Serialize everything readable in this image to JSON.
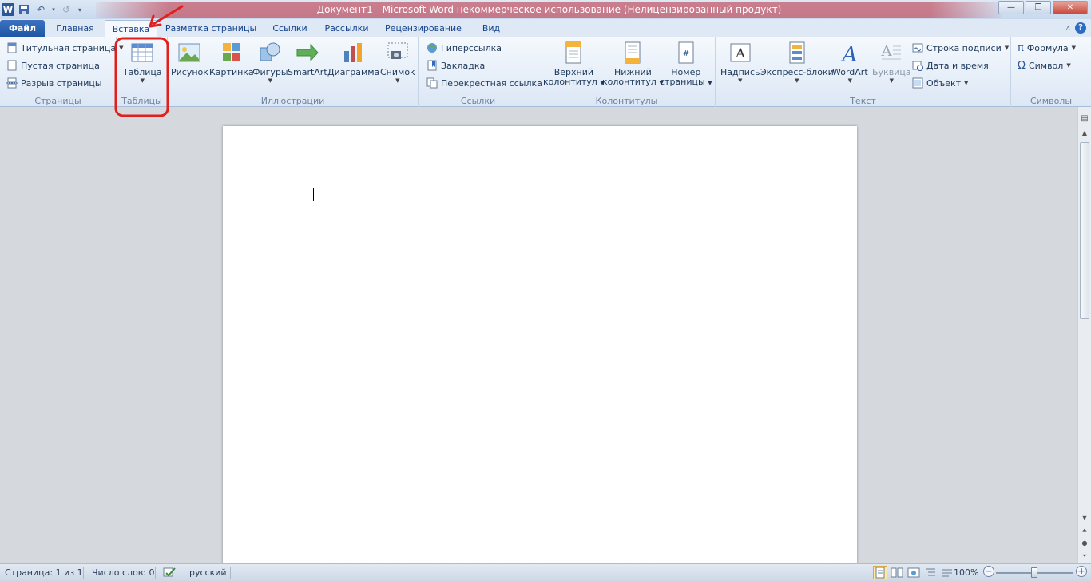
{
  "titlebar": {
    "title": "Документ1 - Microsoft Word некоммерческое использование (Нелицензированный продукт)",
    "app_icon_letter": "W",
    "undo": "↶",
    "redo": "↺",
    "minimize": "—",
    "maximize": "❐",
    "close": "✕"
  },
  "tabs": {
    "file": "Файл",
    "home": "Главная",
    "insert": "Вставка",
    "layout": "Разметка страницы",
    "refs": "Ссылки",
    "mailings": "Рассылки",
    "review": "Рецензирование",
    "view": "Вид"
  },
  "groups": {
    "pages": {
      "label": "Страницы",
      "cover": "Титульная страница",
      "blank": "Пустая страница",
      "break": "Разрыв страницы"
    },
    "tables": {
      "label": "Таблицы",
      "table": "Таблица"
    },
    "illustrations": {
      "label": "Иллюстрации",
      "picture": "Рисунок",
      "clipart": "Картинка",
      "shapes": "Фигуры",
      "smartart": "SmartArt",
      "chart": "Диаграмма",
      "screenshot": "Снимок"
    },
    "links": {
      "label": "Ссылки",
      "hyperlink": "Гиперссылка",
      "bookmark": "Закладка",
      "crossref": "Перекрестная ссылка"
    },
    "headerfooter": {
      "label": "Колонтитулы",
      "header_l1": "Верхний",
      "header_l2": "колонтитул",
      "footer_l1": "Нижний",
      "footer_l2": "колонтитул",
      "pagenum_l1": "Номер",
      "pagenum_l2": "страницы"
    },
    "text": {
      "label": "Текст",
      "textbox": "Надпись",
      "quickparts": "Экспресс-блоки",
      "wordart": "WordArt",
      "dropcap": "Буквица",
      "sigline": "Строка подписи",
      "datetime": "Дата и время",
      "object": "Объект"
    },
    "symbols": {
      "label": "Символы",
      "equation": "Формула",
      "symbol": "Символ",
      "pi": "π",
      "omega": "Ω"
    }
  },
  "statusbar": {
    "page": "Страница: 1 из 1",
    "words": "Число слов: 0",
    "language": "русский",
    "zoom": "100%",
    "zoom_minus": "−",
    "zoom_plus": "+"
  },
  "colors": {
    "annotation": "#e0201c",
    "file_tab": "#2b5fb0",
    "title_highlight": "#c02838"
  }
}
